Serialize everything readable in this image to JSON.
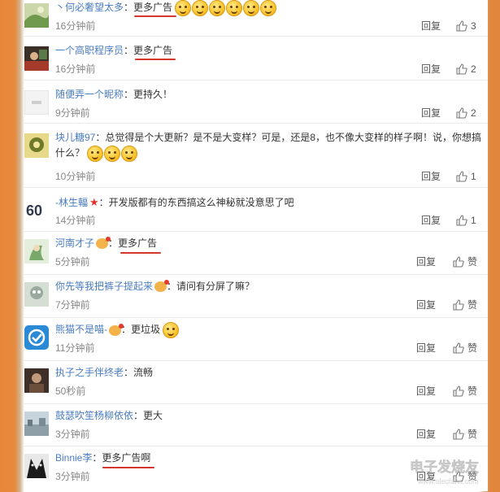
{
  "comments": [
    {
      "user": "丶何必奢望太多",
      "text": "更多广告",
      "time": "16分钟前",
      "reply": "回复",
      "likes": "3",
      "emojis": 6,
      "avatar_color": "#7fa36a"
    },
    {
      "user": "一个高职程序员",
      "text": "更多广告",
      "time": "16分钟前",
      "reply": "回复",
      "likes": "2",
      "emojis": 0,
      "avatar_color": "#5d4a3a"
    },
    {
      "user": "随便弄一个昵称",
      "text": "更持久！",
      "time": "9分钟前",
      "reply": "回复",
      "likes": "2",
      "emojis": 0,
      "avatar_color": "#eeeeee"
    },
    {
      "user": "块儿糖97",
      "text": "总觉得是个大更新？是不是大变样？可是，还是8，也不像大变样的样子啊！说，你想搞什么？",
      "time": "10分钟前",
      "reply": "回复",
      "likes": "1",
      "emojis": 3,
      "avatar_color": "#8a9a42"
    },
    {
      "user": "-林生輻",
      "text": "开发版都有的东西搞这么神秘就没意思了吧",
      "time": "14分钟前",
      "reply": "回复",
      "likes": "1",
      "emojis": 0,
      "avatar_color": "#2f3a4f",
      "avatar_text": "60"
    },
    {
      "user": "河南才子",
      "text": "更多广告",
      "time": "5分钟前",
      "reply": "回复",
      "likes": "赞",
      "emojis": 0,
      "avatar_color": "#cfe4c5"
    },
    {
      "user": "你先等我把裤子提起来",
      "text": "请问有分屏了嘛？",
      "time": "7分钟前",
      "reply": "回复",
      "likes": "赞",
      "emojis": 0,
      "avatar_color": "#b8c6b4"
    },
    {
      "user": "熊猫不是喵-",
      "text": "更垃圾",
      "time": "11分钟前",
      "reply": "回复",
      "likes": "赞",
      "emojis": 1,
      "avatar_color": "#2b8ad6"
    },
    {
      "user": "执子之手伴终老",
      "text": "流畅",
      "time": "50秒前",
      "reply": "回复",
      "likes": "赞",
      "emojis": 0,
      "avatar_color": "#6b4f3c"
    },
    {
      "user": "鼓瑟吹笙杨柳依依",
      "text": "更大",
      "time": "3分钟前",
      "reply": "回复",
      "likes": "赞",
      "emojis": 0,
      "avatar_color": "#9fb0b8"
    },
    {
      "user": "Binnie李",
      "text": "更多广告啊",
      "time": "3分钟前",
      "reply": "回复",
      "likes": "赞",
      "emojis": 0,
      "avatar_color": "#1b1b1b"
    }
  ],
  "watermark": {
    "text": "电子发烧友",
    "url": "www.elecfans.com"
  },
  "colors": {
    "link": "#4a7cc2",
    "underline": "#d4372b",
    "sidebar": "#e5873b"
  }
}
